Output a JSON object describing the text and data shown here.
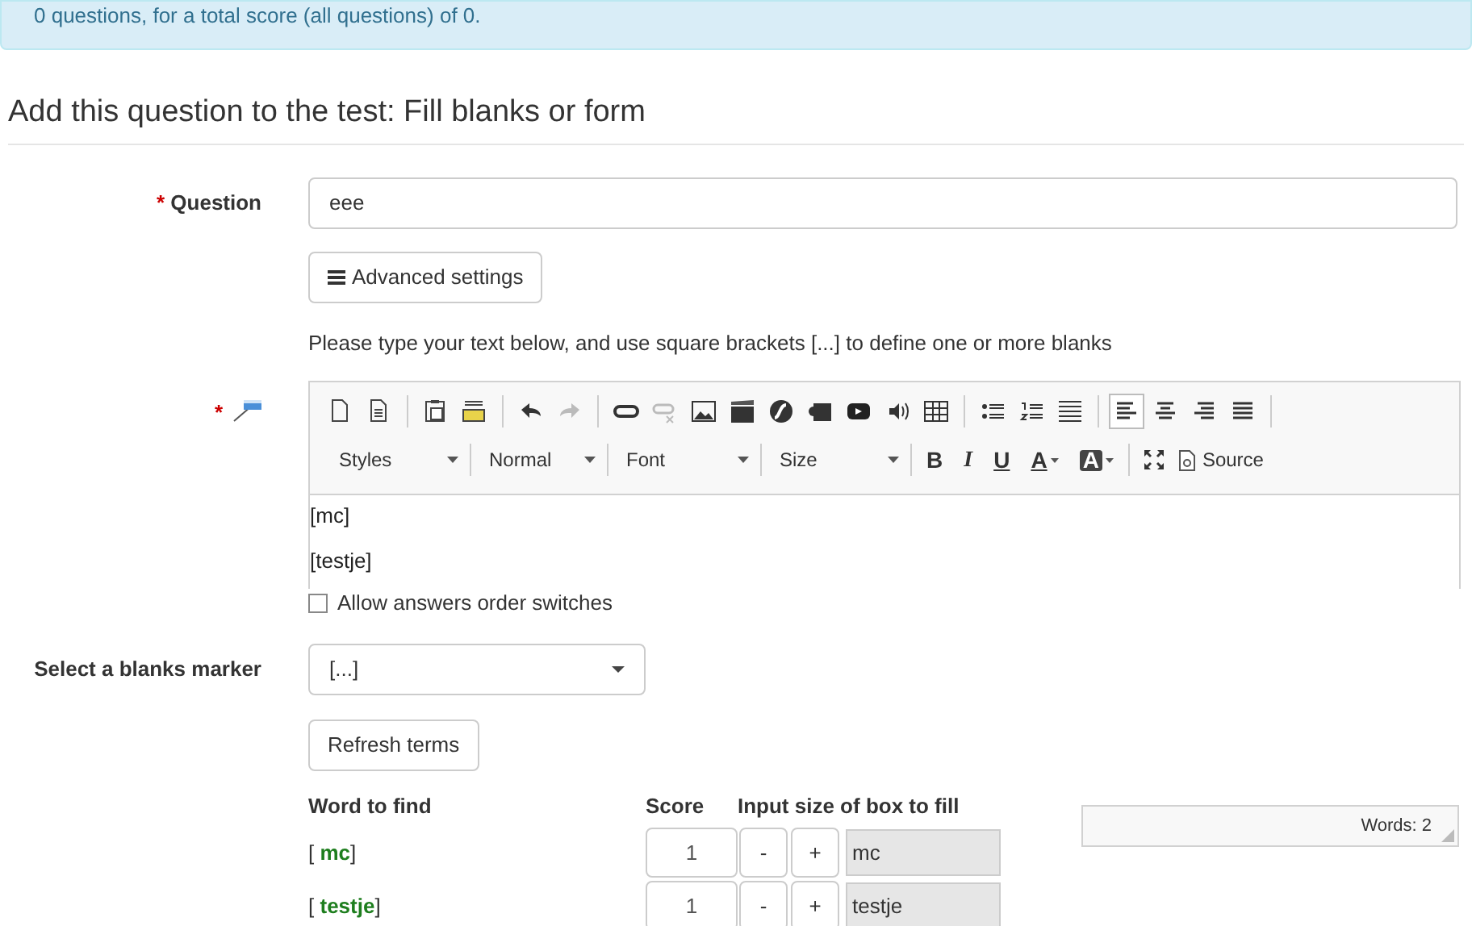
{
  "alert": {
    "text": "0 questions, for a total score (all questions) of 0."
  },
  "heading": "Add this question to the test: Fill blanks or form",
  "question": {
    "required_mark": "*",
    "label": "Question",
    "value": "eee"
  },
  "advanced_button": {
    "label": "Advanced settings"
  },
  "instructions": "Please type your text below, and use square brackets [...] to define one or more blanks",
  "editor": {
    "required_mark": "*",
    "toolbar_groups": [
      [
        {
          "kind": "new-page",
          "disabled": false
        },
        {
          "kind": "templates",
          "disabled": false
        }
      ],
      [
        {
          "kind": "paste-word",
          "disabled": false
        },
        {
          "kind": "paste-html",
          "disabled": false
        }
      ],
      [
        {
          "kind": "undo",
          "disabled": false
        },
        {
          "kind": "redo",
          "disabled": true
        }
      ],
      [
        {
          "kind": "link",
          "disabled": false
        },
        {
          "kind": "unlink",
          "disabled": true
        },
        {
          "kind": "image",
          "disabled": false
        },
        {
          "kind": "film",
          "disabled": false
        },
        {
          "kind": "flash",
          "disabled": false
        },
        {
          "kind": "media",
          "disabled": false
        },
        {
          "kind": "youtube",
          "disabled": false
        },
        {
          "kind": "audio",
          "disabled": false
        },
        {
          "kind": "table",
          "disabled": false
        }
      ],
      [
        {
          "kind": "bullet-list",
          "disabled": false
        },
        {
          "kind": "numbered-list",
          "disabled": false
        },
        {
          "kind": "horizontal-rule",
          "disabled": false
        }
      ]
    ],
    "alignment": [
      {
        "kind": "left",
        "selected": true
      },
      {
        "kind": "center",
        "selected": false
      },
      {
        "kind": "right",
        "selected": false
      },
      {
        "kind": "justify",
        "selected": false
      }
    ],
    "dropdowns": [
      "Styles",
      "Normal",
      "Font",
      "Size"
    ],
    "format_buttons": [
      {
        "kind": "bold",
        "label": "B"
      },
      {
        "kind": "italic",
        "label": "I"
      },
      {
        "kind": "underline",
        "label": "U"
      },
      {
        "kind": "text-color",
        "label": "A"
      },
      {
        "kind": "background-color",
        "label": "A"
      }
    ],
    "source_button": "Source",
    "content": [
      "[mc]",
      "[testje]"
    ],
    "word_count": "Words: 2"
  },
  "order_switch": {
    "label": "Allow answers order switches",
    "checked": false
  },
  "marker": {
    "label": "Select a blanks marker",
    "value": "[...]"
  },
  "refresh_button": "Refresh terms",
  "terms": {
    "columns": [
      "Word to find",
      "Score",
      "Input size of box to fill"
    ],
    "rows": [
      {
        "open": "[",
        "word": "mc",
        "close": "]",
        "score": "1",
        "minus": "-",
        "plus": "+",
        "size_text": "mc"
      },
      {
        "open": "[",
        "word": "testje",
        "close": "]",
        "score": "1",
        "minus": "-",
        "plus": "+",
        "size_text": "testje"
      }
    ]
  }
}
